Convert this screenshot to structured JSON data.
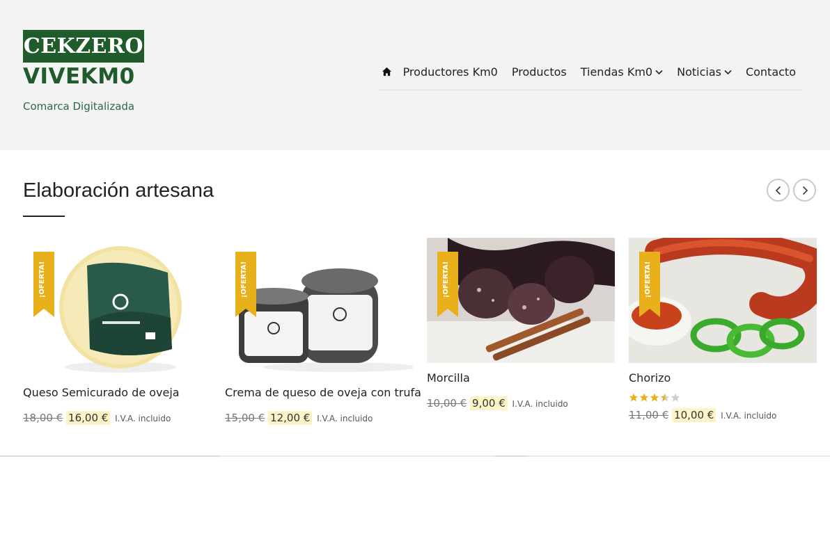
{
  "header": {
    "logo_text": "CEKZERO",
    "site_title": "VIVEKM0",
    "tagline": "Comarca Digitalizada",
    "brand_color": "#1f5b2b"
  },
  "nav": {
    "home_icon": "home-icon",
    "items": [
      {
        "label": "Productores Km0",
        "dropdown": false
      },
      {
        "label": "Productos",
        "dropdown": false
      },
      {
        "label": "Tiendas Km0",
        "dropdown": true
      },
      {
        "label": "Noticias",
        "dropdown": true
      },
      {
        "label": "Contacto",
        "dropdown": false
      }
    ]
  },
  "section": {
    "title": "Elaboración artesana",
    "prev_icon": "chevron-left-icon",
    "next_icon": "chevron-right-icon"
  },
  "badge_text": "¡OFERTA!",
  "badge_color": "#e8b01a",
  "products": [
    {
      "name": "Queso Semicurado de oveja",
      "old_price": "18,00 €",
      "new_price": "16,00 €",
      "tax": "I.V.A. incluido",
      "rating": null
    },
    {
      "name": "Crema de queso de oveja con trufa",
      "old_price": "15,00 €",
      "new_price": "12,00 €",
      "tax": "I.V.A. incluido",
      "rating": null
    },
    {
      "name": "Morcilla",
      "old_price": "10,00 €",
      "new_price": "9,00 €",
      "tax": "I.V.A. incluido",
      "rating": null
    },
    {
      "name": "Chorizo",
      "old_price": "11,00 €",
      "new_price": "10,00 €",
      "tax": "I.V.A. incluido",
      "rating": 3.5
    }
  ]
}
